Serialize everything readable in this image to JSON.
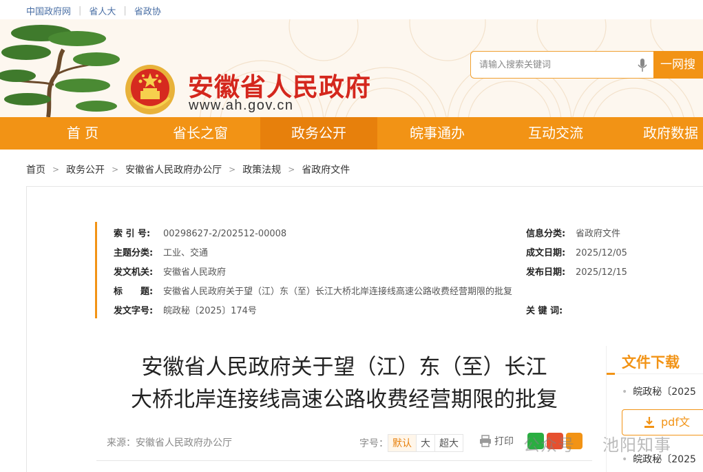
{
  "top_links": [
    "中国政府网",
    "省人大",
    "省政协"
  ],
  "header": {
    "site_title": "安徽省人民政府",
    "site_url": "www.ah.gov.cn",
    "search_placeholder": "请输入搜索关键词",
    "search_button": "一网搜"
  },
  "nav": [
    "首 页",
    "省长之窗",
    "政务公开",
    "皖事通办",
    "互动交流",
    "政府数据"
  ],
  "breadcrumb": [
    "首页",
    "政务公开",
    "安徽省人民政府办公厅",
    "政策法规",
    "省政府文件"
  ],
  "meta": {
    "index_label": "索 引 号:",
    "index_value": "00298627-2/202512-00008",
    "topic_label": "主题分类:",
    "topic_value": "工业、交通",
    "issuer_label": "发文机关:",
    "issuer_value": "安徽省人民政府",
    "title_label": "标　　题:",
    "title_value": "安徽省人民政府关于望（江）东（至）长江大桥北岸连接线高速公路收费经营期限的批复",
    "docno_label": "发文字号:",
    "docno_value": "皖政秘〔2025〕174号",
    "category_label": "信息分类:",
    "category_value": "省政府文件",
    "created_label": "成文日期:",
    "created_value": "2025/12/05",
    "published_label": "发布日期:",
    "published_value": "2025/12/15",
    "keywords_label": "关 键 词:",
    "keywords_value": ""
  },
  "article": {
    "title_line1": "安徽省人民政府关于望（江）东（至）长江",
    "title_line2": "大桥北岸连接线高速公路收费经营期限的批复",
    "source": "来源：安徽省人民政府办公厅",
    "font_label": "字号：",
    "font_sizes": [
      "默认",
      "大",
      "超大"
    ],
    "print_label": "打印"
  },
  "watermark": {
    "part1": "公众号",
    "part2": "池阳知事"
  },
  "download": {
    "title": "文件下载",
    "item1": "皖政秘〔2025",
    "button": "pdf文",
    "item2": "皖政秘〔2025"
  },
  "colors": {
    "accent": "#f29315",
    "brand_red": "#d4271d"
  }
}
